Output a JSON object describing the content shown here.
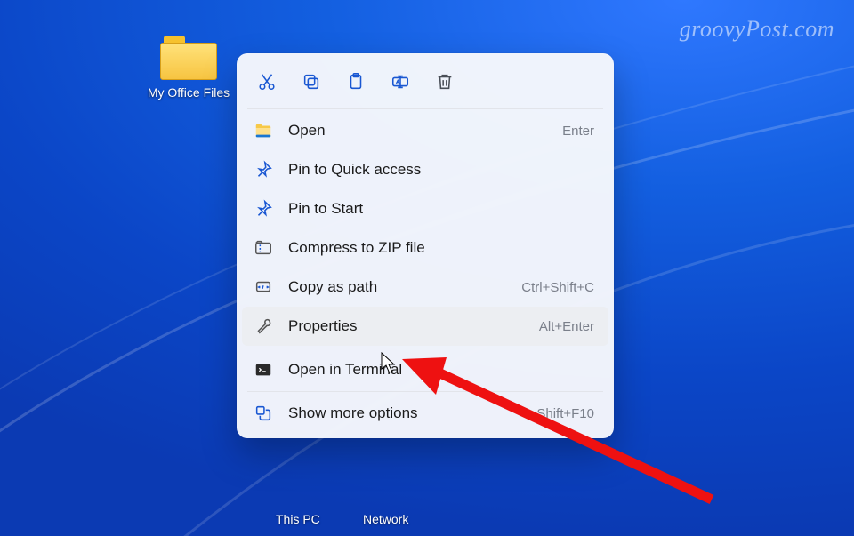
{
  "watermark": "groovyPost.com",
  "desktop": {
    "folder_label": "My Office Files",
    "this_pc_label": "This PC",
    "network_label": "Network"
  },
  "context_menu": {
    "top_actions": [
      {
        "name": "cut-icon"
      },
      {
        "name": "copy-icon"
      },
      {
        "name": "paste-icon"
      },
      {
        "name": "rename-icon"
      },
      {
        "name": "delete-icon"
      }
    ],
    "items": [
      {
        "icon": "open-folder-icon",
        "label": "Open",
        "shortcut": "Enter"
      },
      {
        "icon": "pin-icon",
        "label": "Pin to Quick access",
        "shortcut": ""
      },
      {
        "icon": "pin-icon",
        "label": "Pin to Start",
        "shortcut": ""
      },
      {
        "icon": "zip-icon",
        "label": "Compress to ZIP file",
        "shortcut": ""
      },
      {
        "icon": "copy-path-icon",
        "label": "Copy as path",
        "shortcut": "Ctrl+Shift+C"
      },
      {
        "icon": "properties-icon",
        "label": "Properties",
        "shortcut": "Alt+Enter",
        "hovered": true
      }
    ],
    "terminal": {
      "icon": "terminal-icon",
      "label": "Open in Terminal",
      "shortcut": ""
    },
    "more": {
      "icon": "show-more-icon",
      "label": "Show more options",
      "shortcut": "Shift+F10"
    }
  }
}
